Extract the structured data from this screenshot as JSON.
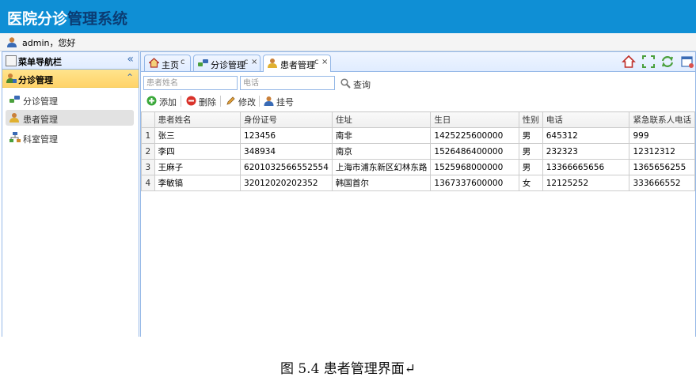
{
  "header": {
    "title_part1": "医院分诊",
    "title_part2": "管理系统"
  },
  "userbar": {
    "greeting": "admin，您好"
  },
  "sidebar": {
    "title": "菜单导航栏",
    "collapse_icon": "«",
    "group": {
      "label": "分诊管理",
      "collapse_icon": "⌃"
    },
    "items": [
      {
        "label": "分诊管理"
      },
      {
        "label": "患者管理"
      },
      {
        "label": "科室管理"
      }
    ]
  },
  "tabs": [
    {
      "label": "主页",
      "refresh": "c"
    },
    {
      "label": "分诊管理",
      "refresh": "c",
      "close": "×"
    },
    {
      "label": "患者管理",
      "refresh": "c",
      "close": "×"
    }
  ],
  "search": {
    "name_placeholder": "患者姓名",
    "phone_placeholder": "电话",
    "query_label": "查询"
  },
  "actions": {
    "add": "添加",
    "delete": "删除",
    "edit": "修改",
    "register": "挂号"
  },
  "table": {
    "columns": [
      "患者姓名",
      "身份证号",
      "住址",
      "生日",
      "性别",
      "电话",
      "紧急联系人电话"
    ],
    "rows": [
      {
        "idx": "1",
        "cells": [
          "张三",
          "123456",
          "南非",
          "1425225600000",
          "男",
          "645312",
          "999"
        ]
      },
      {
        "idx": "2",
        "cells": [
          "李四",
          "348934",
          "南京",
          "1526486400000",
          "男",
          "232323",
          "12312312"
        ]
      },
      {
        "idx": "3",
        "cells": [
          "王麻子",
          "6201032566552554",
          "上海市浦东新区幻林东路",
          "1525968000000",
          "男",
          "13366665656",
          "1365656255"
        ]
      },
      {
        "idx": "4",
        "cells": [
          "李敏镐",
          "32012020202352",
          "韩国首尔",
          "1367337600000",
          "女",
          "12125252",
          "333666552"
        ]
      }
    ]
  },
  "caption": "图 5.4 患者管理界面↵",
  "colors": {
    "header_bg": "#0f8fd5",
    "border": "#95b8e7",
    "selected_group": "#ffd369"
  }
}
